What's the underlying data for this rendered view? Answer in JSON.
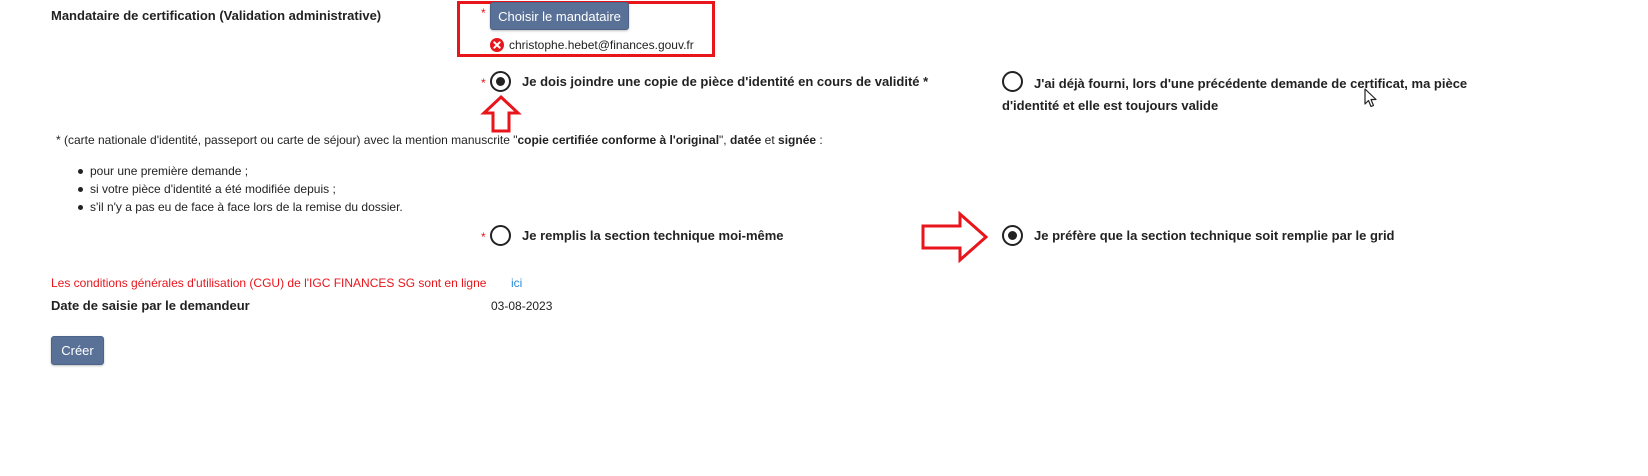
{
  "mandataire": {
    "label": "Mandataire de certification (Validation administrative)",
    "required_mark": "*",
    "choose_button": "Choisir le mandataire",
    "selected_email": "christophe.hebet@finances.gouv.fr"
  },
  "identity_choice": {
    "required_mark": "*",
    "option1": "Je dois joindre une copie de pièce d'identité en cours de validité *",
    "option1_checked": true,
    "option2": "J'ai déjà fourni, lors d'une précédente demande de certificat, ma pièce d'identité et elle est toujours valide",
    "option2_checked": false
  },
  "note": {
    "prefix": "* (carte nationale d'identité, passeport ou carte de séjour) avec la mention manuscrite \"",
    "bold1": "copie certifiée conforme à l'original",
    "mid": "\", ",
    "bold2": "datée",
    "and": " et ",
    "bold3": "signée",
    "suffix": " :",
    "bullets": [
      "pour une première demande ;",
      "si votre pièce d'identité a été modifiée depuis ;",
      "s'il n'y a pas eu de face à face lors de la remise du dossier."
    ]
  },
  "technical_choice": {
    "required_mark": "*",
    "option1": "Je remplis la section technique moi-même",
    "option1_checked": false,
    "option2": "Je préfère que la section technique soit remplie par le grid",
    "option2_checked": true
  },
  "cgu": {
    "text": "Les conditions générales d'utilisation (CGU) de l'IGC FINANCES SG sont en ligne",
    "link": "ici"
  },
  "date": {
    "label": "Date de saisie par le demandeur",
    "value": "03-08-2023"
  },
  "create_button": "Créer",
  "colors": {
    "accent_red": "#e8151b",
    "button_blue": "#5a7197",
    "link_blue": "#2a8bd8"
  }
}
